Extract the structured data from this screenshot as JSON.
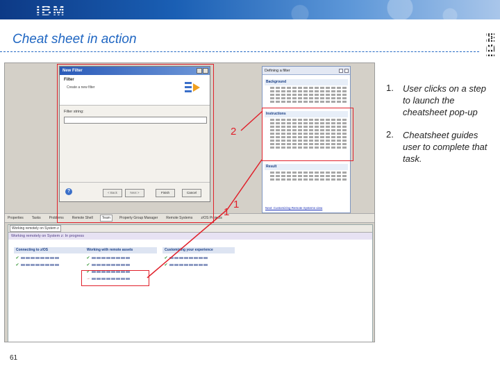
{
  "header": {
    "logo_text": "IBM"
  },
  "slide": {
    "title": "Cheat sheet in action",
    "side_logo_text": "IBM",
    "page_number": "61"
  },
  "steps": [
    {
      "number": "1.",
      "text": "User clicks on a step to launch the cheatsheet pop-up"
    },
    {
      "number": "2.",
      "text": "Cheatsheet guides user to complete that task."
    }
  ],
  "annotations": {
    "label_2": "2",
    "label_1a": "1",
    "label_1b": "1"
  },
  "dialog": {
    "titlebar": "New Filter",
    "heading": "Filter",
    "subtitle": "Create a new filter",
    "field_label": "Filter string:",
    "buttons": [
      "< Back",
      "Next >",
      "Finish",
      "Cancel"
    ]
  },
  "cheatsheet": {
    "title": "Defining a filter",
    "sections": [
      "Background",
      "Instructions",
      "Result"
    ],
    "link": "Next: Customizing Remote Systems view"
  },
  "workbench": {
    "tabs": [
      "Properties",
      "Tasks",
      "Problems",
      "Remote Shell",
      "Team",
      "Property Group Manager",
      "Remote Systems",
      "z/OS Projects"
    ],
    "panel_tabs": [
      "Working remotely on System z"
    ],
    "status": "Working remotely on System z: In progress",
    "columns": [
      {
        "heading": "Connecting to z/OS",
        "items": 2
      },
      {
        "heading": "Working with remote assets",
        "items": 4
      },
      {
        "heading": "Customizing your experience",
        "items": 2
      }
    ]
  },
  "colors": {
    "accent_red": "#e0202a",
    "title_blue": "#1f66c2"
  }
}
